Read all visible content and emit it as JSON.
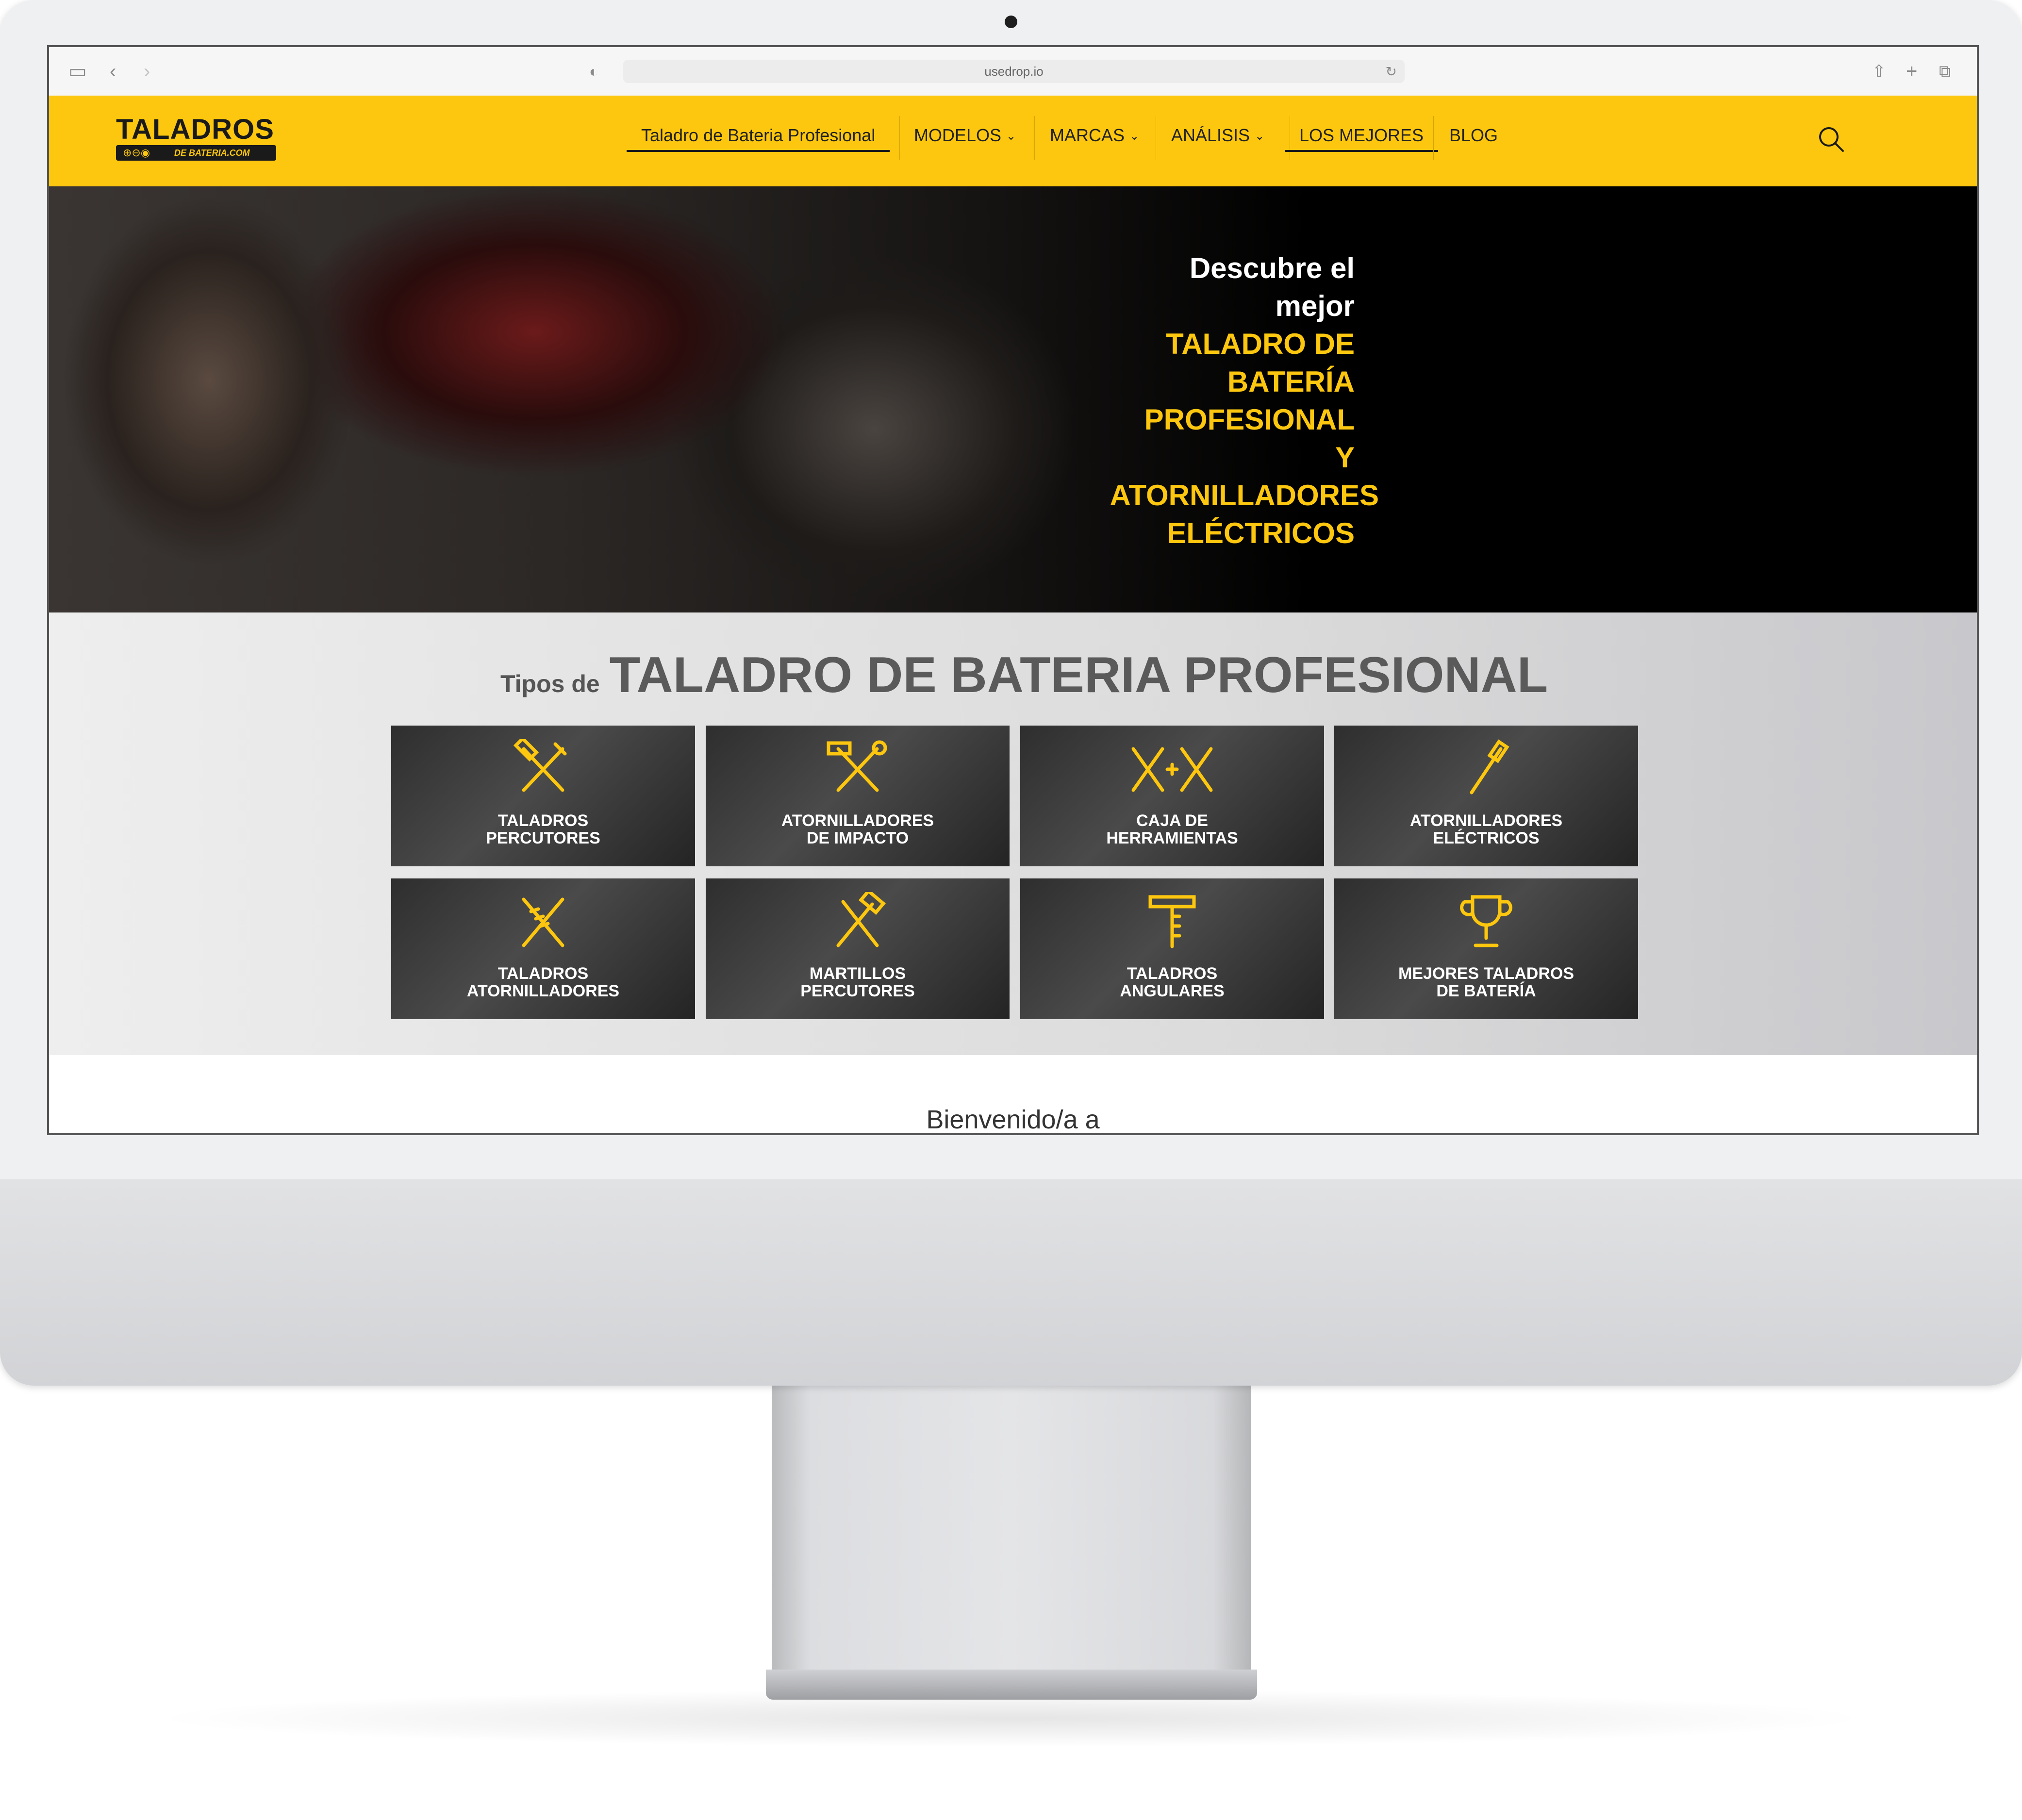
{
  "browser": {
    "url": "usedrop.io"
  },
  "site": {
    "logo": {
      "main": "TALADROS",
      "sub": "DE BATERIA.COM"
    },
    "nav": [
      {
        "label": "Taladro de Bateria Profesional",
        "dropdown": false,
        "active": true
      },
      {
        "label": "MODELOS",
        "dropdown": true,
        "active": false
      },
      {
        "label": "MARCAS",
        "dropdown": true,
        "active": false
      },
      {
        "label": "ANÁLISIS",
        "dropdown": true,
        "active": false
      },
      {
        "label": "LOS MEJORES",
        "dropdown": false,
        "active": true
      },
      {
        "label": "BLOG",
        "dropdown": false,
        "active": false
      }
    ],
    "chevron": "⌄"
  },
  "hero": {
    "line1": "Descubre el",
    "line2": "mejor",
    "line3": "TALADRO DE",
    "line4": "BATERÍA",
    "line5": "PROFESIONAL",
    "line6": "Y",
    "line7": "ATORNILLADORES",
    "line8": "ELÉCTRICOS"
  },
  "types": {
    "small": "Tipos de",
    "big": "TALADRO DE BATERIA PROFESIONAL",
    "tiles": [
      {
        "line1": "TALADROS",
        "line2": "PERCUTORES",
        "icon": "drill-hammer-icon"
      },
      {
        "line1": "ATORNILLADORES",
        "line2": "DE IMPACTO",
        "icon": "hammer-wrench-icon"
      },
      {
        "line1": "CAJA DE",
        "line2": "HERRAMIENTAS",
        "icon": "toolbox-icon"
      },
      {
        "line1": "ATORNILLADORES",
        "line2": "ELÉCTRICOS",
        "icon": "screwdriver-icon"
      },
      {
        "line1": "TALADROS",
        "line2": "ATORNILLADORES",
        "icon": "drill-screwdriver-icon"
      },
      {
        "line1": "MARTILLOS",
        "line2": "PERCUTORES",
        "icon": "hammer-icon"
      },
      {
        "line1": "TALADROS",
        "line2": "ANGULARES",
        "icon": "angle-ruler-icon"
      },
      {
        "line1": "MEJORES TALADROS",
        "line2": "DE BATERÍA",
        "icon": "trophy-icon"
      }
    ]
  },
  "welcome": "Bienvenido/a a",
  "colors": {
    "brand_yellow": "#fcc70e",
    "dark": "#1a1a1a"
  }
}
